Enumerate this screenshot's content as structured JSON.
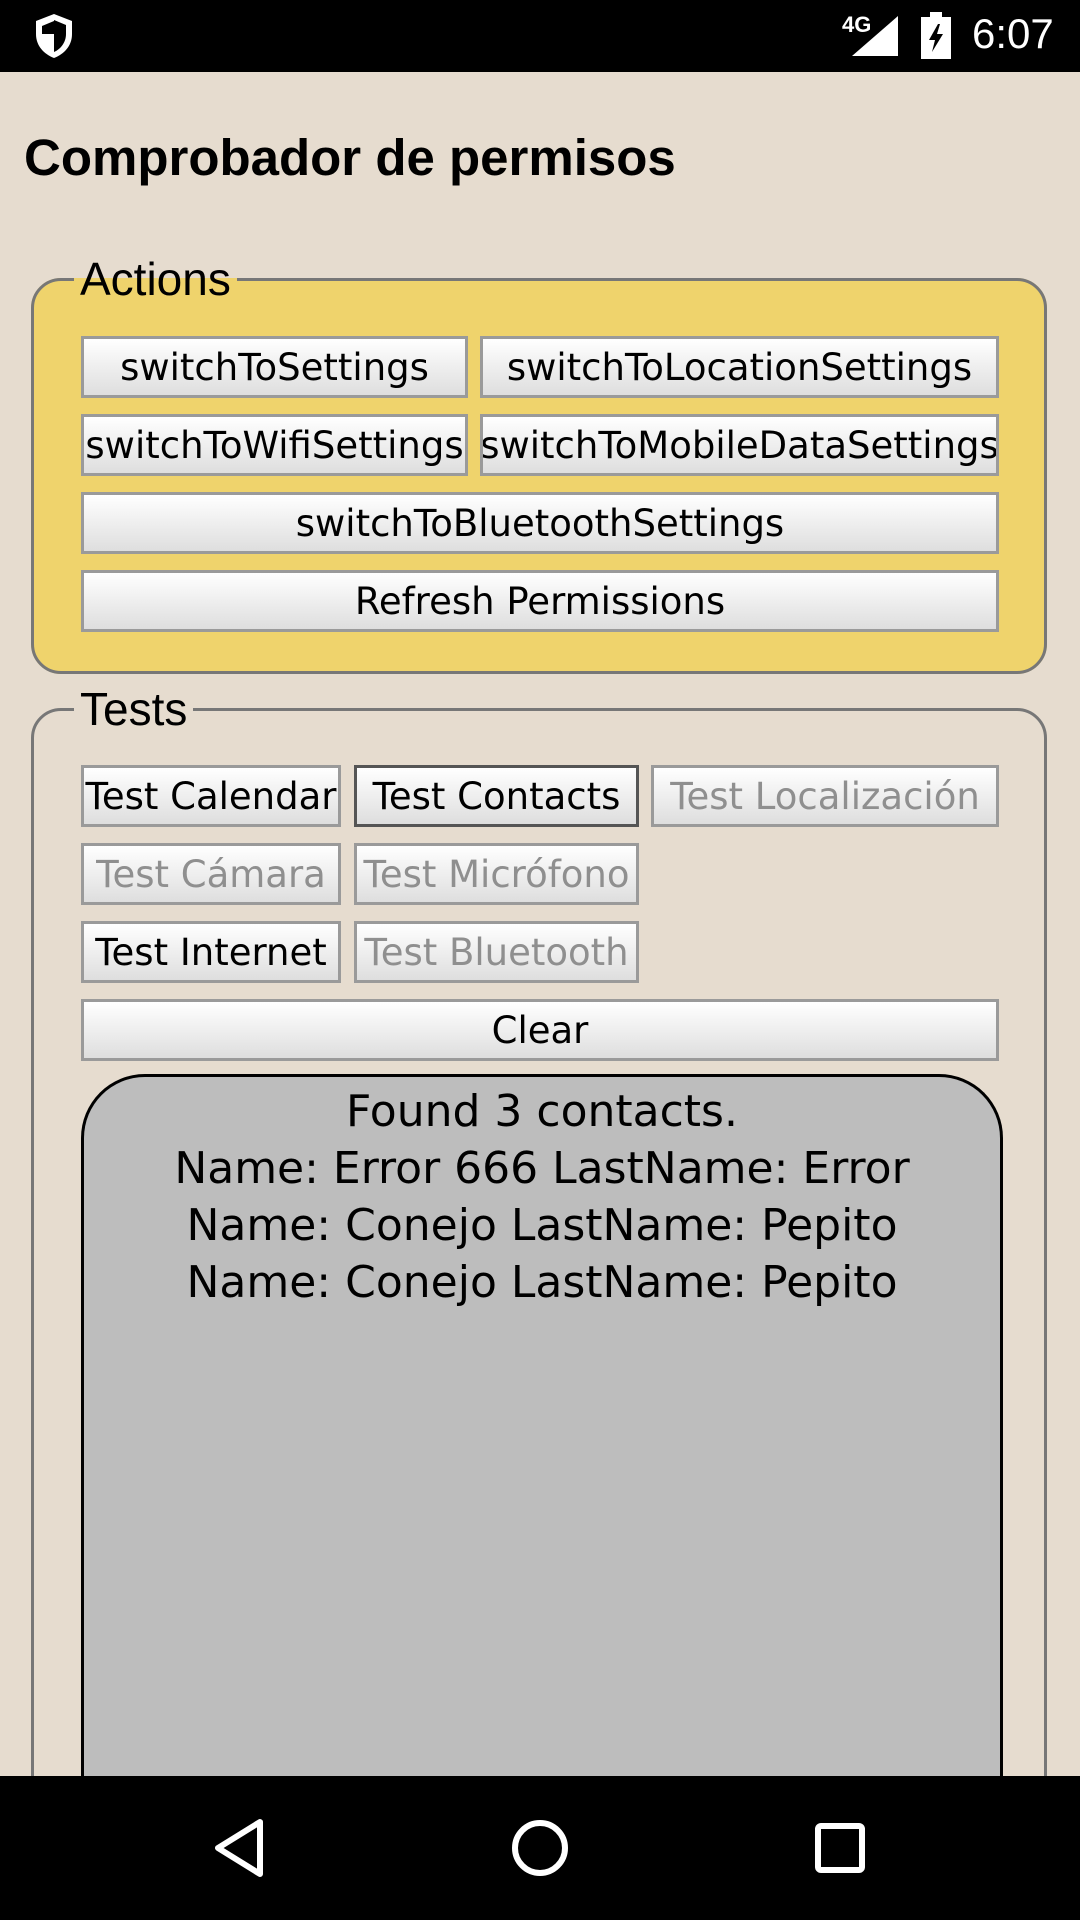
{
  "status_bar": {
    "network": "4G",
    "time": "6:07",
    "icons": [
      "shield-icon",
      "signal-icon",
      "battery-charging-icon"
    ]
  },
  "app": {
    "title": "Comprobador de permisos"
  },
  "actions": {
    "legend": "Actions",
    "buttons": {
      "settings": "switchToSettings",
      "location": "switchToLocationSettings",
      "wifi": "switchToWifiSettings",
      "mobile_data": "switchToMobileDataSettings",
      "bluetooth": "switchToBluetoothSettings",
      "refresh": "Refresh Permissions"
    }
  },
  "tests": {
    "legend": "Tests",
    "buttons": {
      "calendar": "Test Calendar",
      "contacts": "Test Contacts",
      "location": "Test Localización",
      "camera": "Test Cámara",
      "microphone": "Test Micrófono",
      "internet": "Test Internet",
      "bluetooth": "Test Bluetooth",
      "clear": "Clear"
    },
    "output": [
      "Found 3 contacts.",
      "Name: Error 666 LastName: Error",
      "Name: Conejo LastName: Pepito",
      "Name: Conejo LastName: Pepito"
    ]
  },
  "nav_bar": {
    "icons": [
      "back-icon",
      "home-icon",
      "recent-apps-icon"
    ]
  },
  "colors": {
    "background": "#e6dccf",
    "actions_panel": "#efd36c",
    "results_panel": "#bdbdbd",
    "disabled_text": "#8f8f8f"
  }
}
